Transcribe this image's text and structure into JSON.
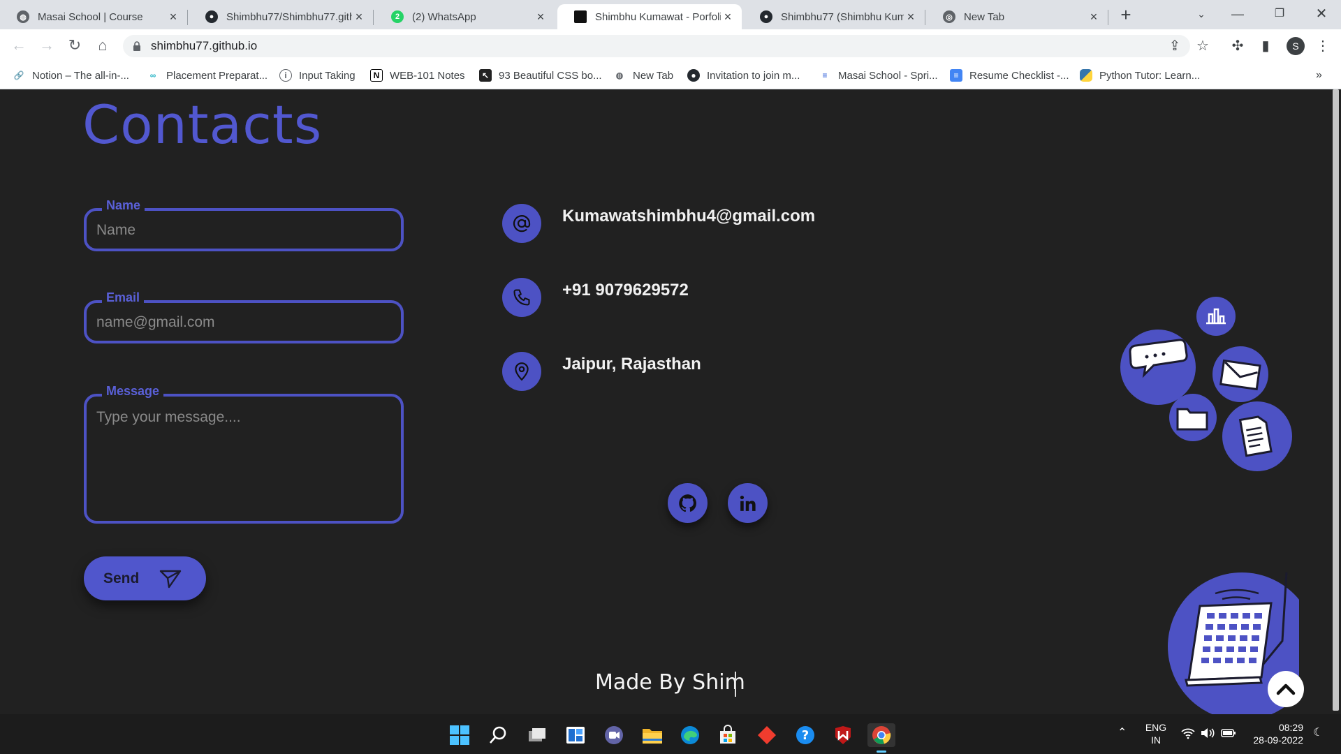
{
  "browser": {
    "tabs": [
      {
        "label": "Masai School | Course",
        "icon": "globe-icon"
      },
      {
        "label": "Shimbhu77/Shimbhu77.gith",
        "icon": "github-icon"
      },
      {
        "label": "(2) WhatsApp",
        "icon": "whatsapp-icon",
        "badge": "2"
      },
      {
        "label": "Shimbhu Kumawat - Porfoli",
        "icon": "site-icon",
        "active": true
      },
      {
        "label": "Shimbhu77 (Shimbhu Kuma",
        "icon": "github-icon"
      },
      {
        "label": "New Tab",
        "icon": "chrome-icon"
      }
    ],
    "url": "shimbhu77.github.io",
    "profile_initial": "S",
    "bookmarks": [
      {
        "label": "Notion – The all-in-...",
        "icon": "link-icon"
      },
      {
        "label": "Placement Preparat...",
        "icon": "infinity-icon"
      },
      {
        "label": "Input Taking",
        "icon": "clock-icon"
      },
      {
        "label": "WEB-101 Notes",
        "icon": "notion-icon"
      },
      {
        "label": "93 Beautiful CSS bo...",
        "icon": "cursor-icon"
      },
      {
        "label": "New Tab",
        "icon": "chrome-icon"
      },
      {
        "label": "Invitation to join m...",
        "icon": "github-icon"
      },
      {
        "label": "Masai School - Spri...",
        "icon": "masai-icon"
      },
      {
        "label": "Resume Checklist -...",
        "icon": "docs-icon"
      },
      {
        "label": "Python Tutor: Learn...",
        "icon": "python-icon"
      }
    ],
    "bookmarks_overflow": "»"
  },
  "page": {
    "title": "Contacts",
    "form": {
      "name_label": "Name",
      "name_placeholder": "Name",
      "email_label": "Email",
      "email_placeholder": "name@gmail.com",
      "message_label": "Message",
      "message_placeholder": "Type your message....",
      "send_label": "Send"
    },
    "contact": {
      "email": "Kumawatshimbhu4@gmail.com",
      "phone": "+91 9079629572",
      "location": "Jaipur, Rajasthan"
    },
    "footer": "Made By Shim",
    "accent_color": "#4d52c4"
  },
  "taskbar": {
    "apps": [
      "windows-start-icon",
      "search-icon",
      "task-view-icon",
      "widgets-icon",
      "teams-chat-icon",
      "file-explorer-icon",
      "edge-icon",
      "store-icon",
      "git-icon",
      "help-icon",
      "mcafee-icon",
      "chrome-icon"
    ],
    "language_line1": "ENG",
    "language_line2": "IN",
    "time": "08:29",
    "date": "28-09-2022"
  }
}
